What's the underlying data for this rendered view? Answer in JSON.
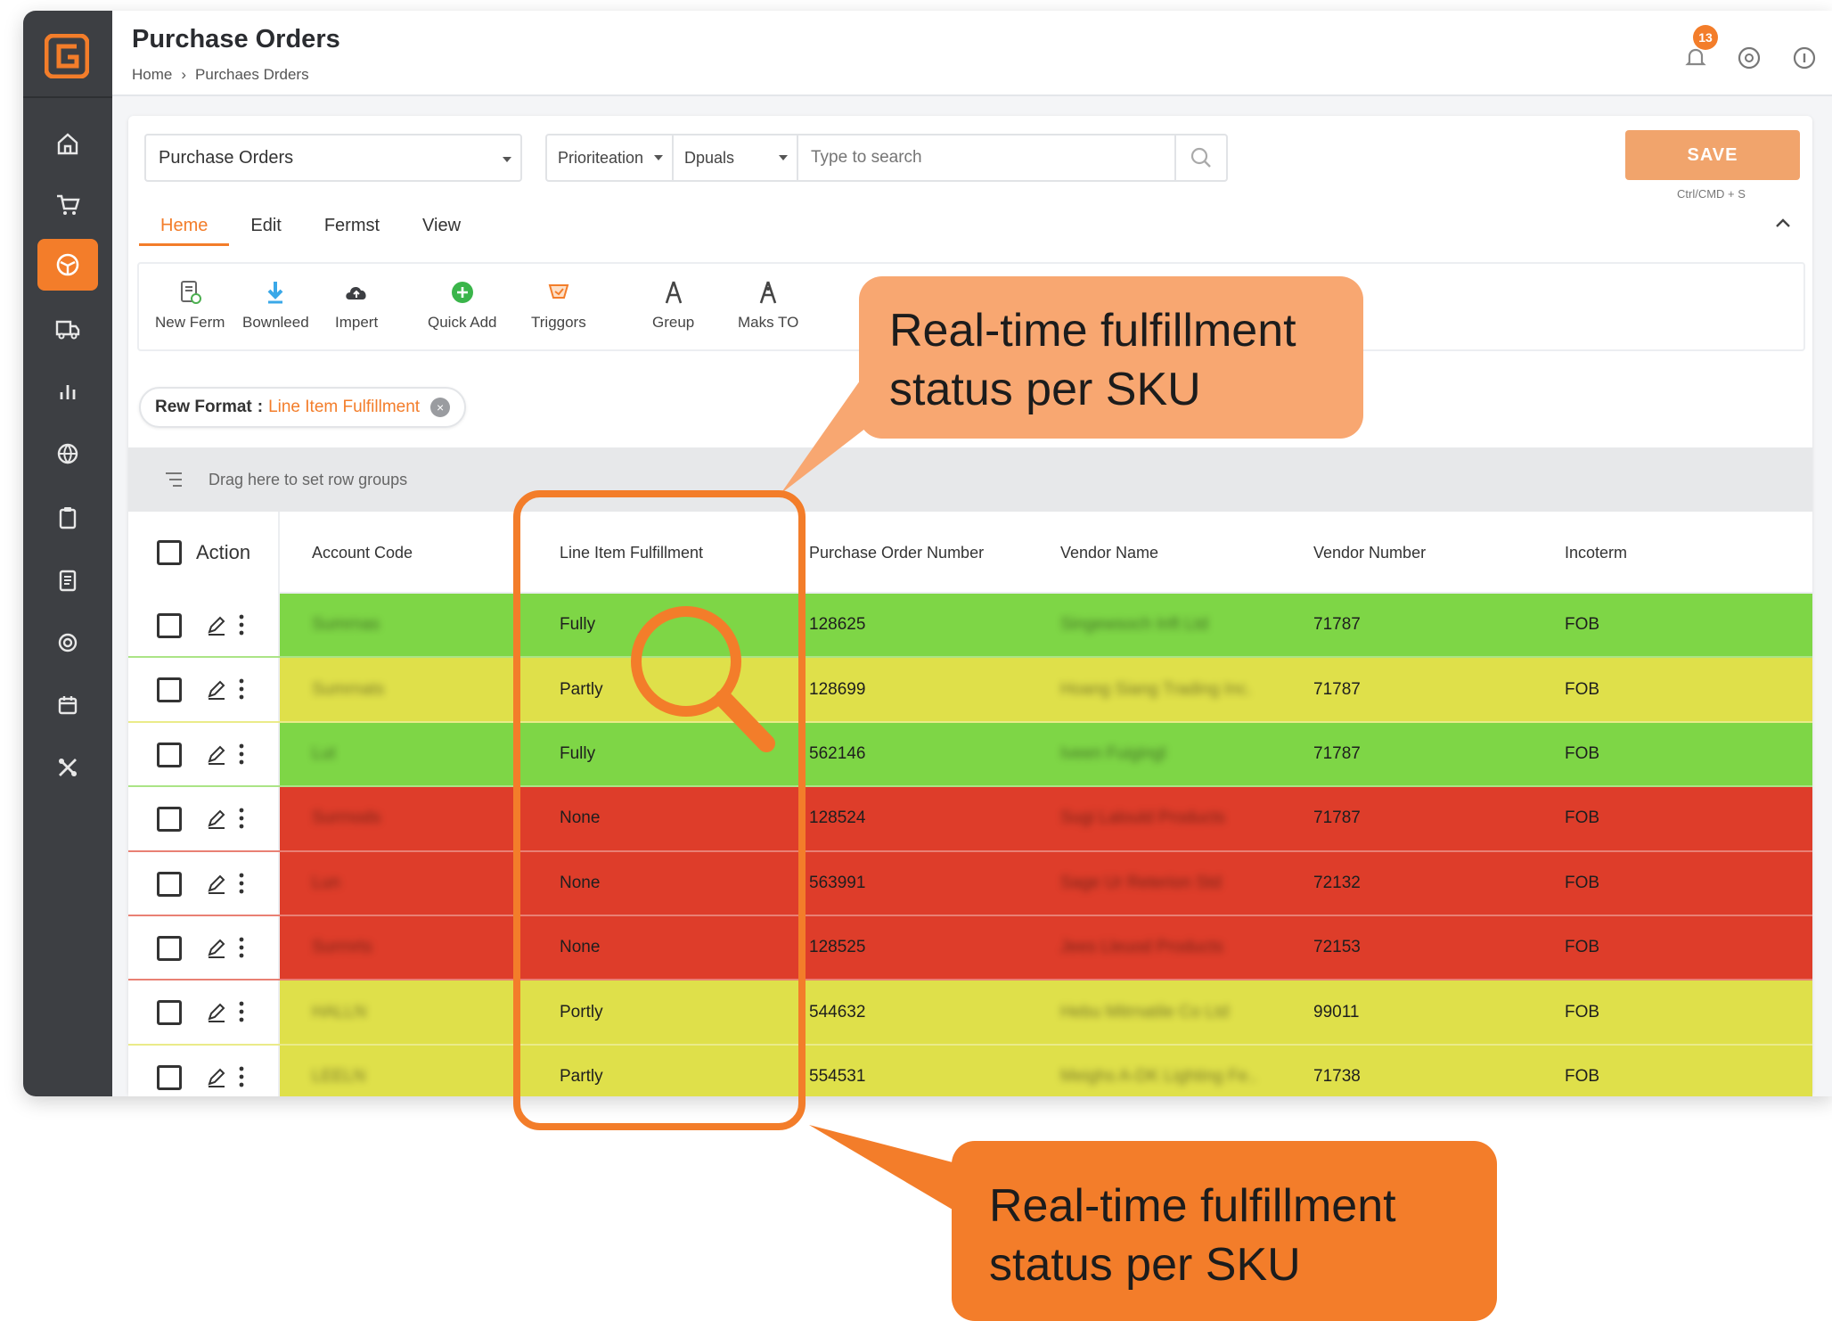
{
  "header": {
    "title": "Purchase Orders",
    "breadcrumb": [
      "Home",
      "Purchaes Drders"
    ],
    "notification_count": "13"
  },
  "toolbar": {
    "view_select": "Purchase Orders",
    "filter_select_1": "Prioriteation",
    "filter_select_2": "Dpuals",
    "search_placeholder": "Type to search",
    "save_label": "SAVE",
    "save_hint": "Ctrl/CMD + S"
  },
  "tabs": [
    "Heme",
    "Edit",
    "Fermst",
    "View"
  ],
  "ribbon": [
    {
      "label": "New Ferm",
      "icon": "new-form-icon"
    },
    {
      "label": "Bownleed",
      "icon": "download-icon"
    },
    {
      "label": "Impert",
      "icon": "import-icon"
    },
    {
      "label": "Quick Add",
      "icon": "quick-add-icon"
    },
    {
      "label": "Triggors",
      "icon": "triggers-icon"
    },
    {
      "label": "Greup",
      "icon": "group-icon"
    },
    {
      "label": "Maks TO",
      "icon": "make-to-icon"
    }
  ],
  "row_format": {
    "label": "Rew Format",
    "value": "Line Item Fulfillment"
  },
  "group_bar": {
    "text": "Drag here to set row groups"
  },
  "table": {
    "columns": [
      "Action",
      "Account Code",
      "Line Item Fulfillment",
      "Purchase Order Number",
      "Vendor Name",
      "Vendor Number",
      "Incoterm"
    ],
    "rows": [
      {
        "status": "green",
        "account": "Sumrnas",
        "fulfillment": "Fully",
        "po": "128625",
        "vendor": "Singewsoch Inft Ltd",
        "vendor_no": "71787",
        "incoterm": "FOB"
      },
      {
        "status": "yellow",
        "account": "Sumrnats",
        "fulfillment": "Partly",
        "po": "128699",
        "vendor": "Hoang Siang Trading Inc.",
        "vendor_no": "71787",
        "incoterm": "FOB"
      },
      {
        "status": "green",
        "account": "Lut",
        "fulfillment": "Fully",
        "po": "562146",
        "vendor": "Iveen Fuigingl",
        "vendor_no": "71787",
        "incoterm": "FOB"
      },
      {
        "status": "red",
        "account": "Surrnods",
        "fulfillment": "None",
        "po": "128524",
        "vendor": "Sugi Lalould Products",
        "vendor_no": "71787",
        "incoterm": "FOB"
      },
      {
        "status": "red",
        "account": "Lun",
        "fulfillment": "None",
        "po": "563991",
        "vendor": "Sage Ur Reterion Std",
        "vendor_no": "72132",
        "incoterm": "FOB"
      },
      {
        "status": "red",
        "account": "Surrnrts",
        "fulfillment": "None",
        "po": "128525",
        "vendor": "Jees Lleuod Products",
        "vendor_no": "72153",
        "incoterm": "FOB"
      },
      {
        "status": "yellow",
        "account": "HALLN",
        "fulfillment": "Portly",
        "po": "544632",
        "vendor": "Hebu Mitrnatile Co Ltd",
        "vendor_no": "99011",
        "incoterm": "FOB"
      },
      {
        "status": "yellow",
        "account": "LEELN",
        "fulfillment": "Partly",
        "po": "554531",
        "vendor": "Meighs A-DK Lighting Fe..",
        "vendor_no": "71738",
        "incoterm": "FOB"
      }
    ]
  },
  "annotations": {
    "callout_top": [
      "Real-time fulfillment",
      "status per SKU"
    ],
    "callout_bottom": [
      "Real-time fulfillment",
      "status per SKU"
    ]
  },
  "colors": {
    "accent": "#f37d2a",
    "fully": "#7ed646",
    "partly": "#dfe04a",
    "none": "#de3d2a",
    "sidebar": "#3d3f43"
  },
  "sidebar_icons": [
    "home-icon",
    "cart-icon",
    "box-icon",
    "truck-icon",
    "chart-icon",
    "globe-icon",
    "clipboard-icon",
    "document-icon",
    "settings-icon",
    "calendar-icon",
    "tools-icon"
  ]
}
